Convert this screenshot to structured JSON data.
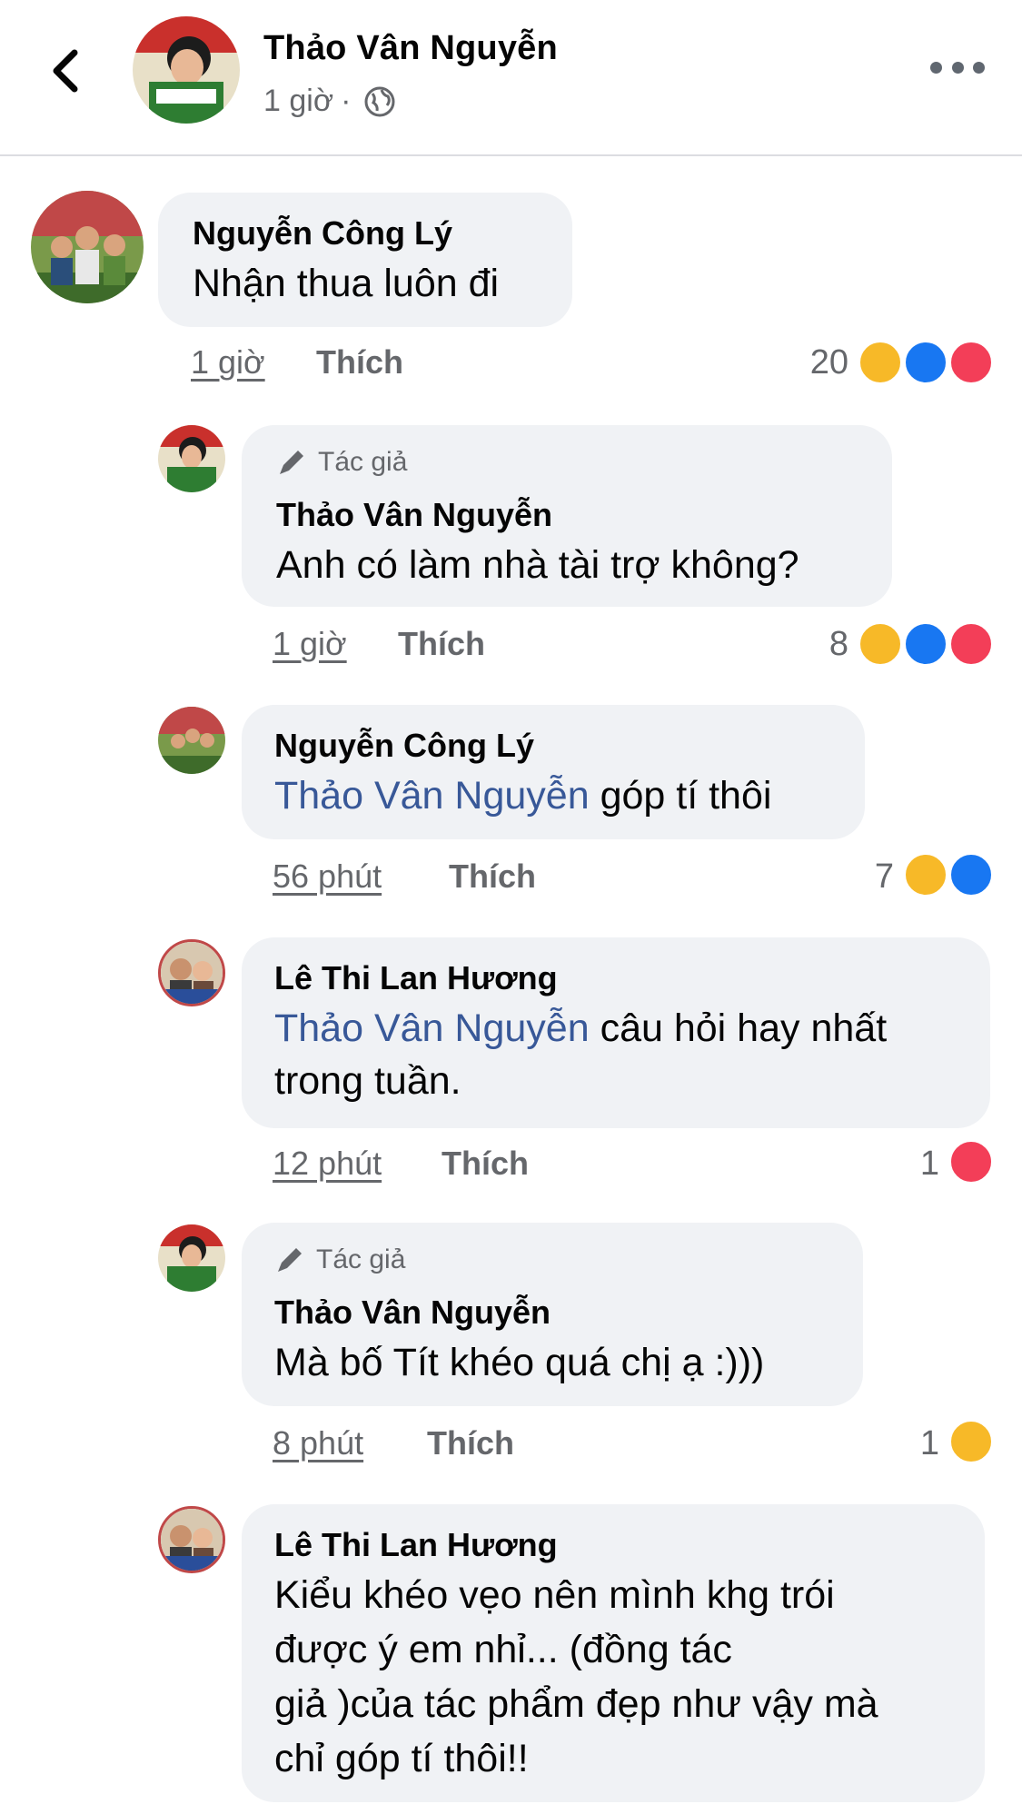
{
  "header": {
    "name": "Thảo Vân Nguyễn",
    "time": "1 giờ",
    "separator": "·"
  },
  "comments": [
    {
      "name": "Nguyễn Công Lý",
      "text": "Nhận thua luôn đi",
      "time": "1 giờ",
      "like_label": "Thích",
      "reaction_count": "20",
      "reactions": [
        "haha",
        "like",
        "love"
      ]
    },
    {
      "author_badge": "Tác giả",
      "name": "Thảo Vân Nguyễn",
      "text": "Anh có làm nhà tài trợ không?",
      "time": "1 giờ",
      "like_label": "Thích",
      "reaction_count": "8",
      "reactions": [
        "haha",
        "like",
        "love"
      ]
    },
    {
      "name": "Nguyễn Công Lý",
      "mention": "Thảo Vân Nguyễn",
      "text": " góp tí thôi",
      "time": "56 phút",
      "like_label": "Thích",
      "reaction_count": "7",
      "reactions": [
        "haha",
        "like"
      ]
    },
    {
      "name": "Lê Thi Lan Hương",
      "mention": "Thảo Vân Nguyễn",
      "text_line1": " câu hỏi hay nhất",
      "text_line2": "trong tuần.",
      "time": "12 phút",
      "like_label": "Thích",
      "reaction_count": "1",
      "reactions": [
        "love"
      ]
    },
    {
      "author_badge": "Tác giả",
      "name": "Thảo Vân Nguyễn",
      "text": "Mà bố Tít khéo quá chị ạ :)))",
      "time": "8 phút",
      "like_label": "Thích",
      "reaction_count": "1",
      "reactions": [
        "haha"
      ]
    },
    {
      "name": "Lê Thi Lan Hương",
      "text_lines": [
        "Kiểu khéo vẹo nên mình khg trói",
        "được ý em nhỉ... (đồng tác",
        "giả )của tác phẩm đẹp như vậy mà",
        "chỉ góp tí thôi!!"
      ]
    }
  ],
  "colors": {
    "haha": "#f7b928",
    "like": "#1877f2",
    "love": "#f33e58",
    "mention": "#385898",
    "bubble": "#f0f2f5",
    "meta": "#65676b"
  },
  "icons": {
    "back": "chevron-left-icon",
    "globe": "globe-icon",
    "more": "more-icon",
    "author": "pencil-icon"
  }
}
